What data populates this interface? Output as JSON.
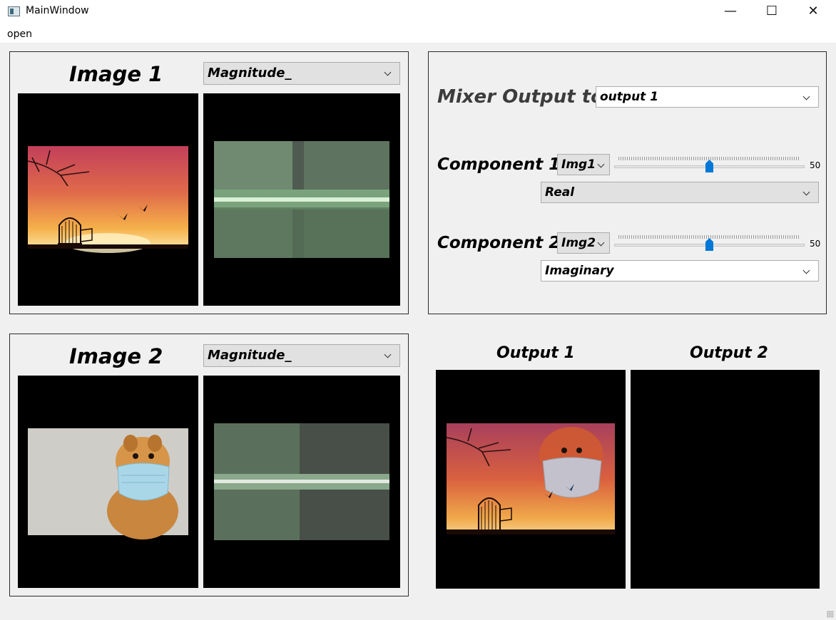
{
  "window": {
    "title": "MainWindow",
    "minimize": "—",
    "maximize": "☐",
    "close": "✕"
  },
  "menu": {
    "open": "open"
  },
  "image1": {
    "title": "Image 1",
    "component": "Magnitude_"
  },
  "image2": {
    "title": "Image 2",
    "component": "Magnitude_"
  },
  "mixer": {
    "output_label": "Mixer Output to :",
    "output_target": "output 1",
    "component1": {
      "label": "Component 1 :",
      "image": "Img1",
      "ratio": 50,
      "ratio_text": "50",
      "type": "Real"
    },
    "component2": {
      "label": "Component 2 :",
      "image": "Img2",
      "ratio": 50,
      "ratio_text": "50",
      "type": "Imaginary"
    }
  },
  "outputs": {
    "output1": "Output 1",
    "output2": "Output 2"
  },
  "colors": {
    "accent": "#0078d7",
    "canvas": "#000000",
    "frame": "#2b2b2b"
  }
}
